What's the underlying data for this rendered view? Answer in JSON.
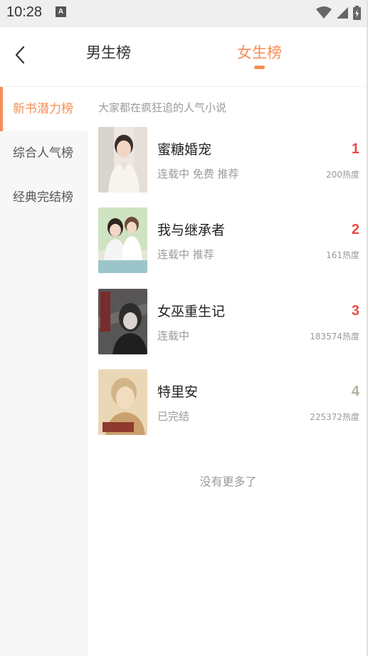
{
  "status_bar": {
    "time": "10:28",
    "notification_letter": "A",
    "icons": [
      "wifi-icon",
      "signal-icon",
      "battery-charging-icon"
    ]
  },
  "header": {
    "back_icon": "back-chevron-icon",
    "tabs": [
      {
        "label": "男生榜",
        "active": false
      },
      {
        "label": "女生榜",
        "active": true
      }
    ],
    "accent_color": "#f58d55"
  },
  "sidebar": {
    "items": [
      {
        "label": "新书潜力榜",
        "active": true
      },
      {
        "label": "综合人气榜",
        "active": false
      },
      {
        "label": "经典完结榜",
        "active": false
      }
    ]
  },
  "content": {
    "subtitle": "大家都在疯狂追的人气小说",
    "books": [
      {
        "rank": "1",
        "title": "蜜糖婚宠",
        "tags": "连载中 免费 推荐",
        "heat": "200热度",
        "rank_color": "#e94b45"
      },
      {
        "rank": "2",
        "title": "我与继承者",
        "tags": "连载中 推荐",
        "heat": "161热度",
        "rank_color": "#e94b45"
      },
      {
        "rank": "3",
        "title": "女巫重生记",
        "tags": "连载中",
        "heat": "183574热度",
        "rank_color": "#e94b45"
      },
      {
        "rank": "4",
        "title": "特里安",
        "tags": "已完结",
        "heat": "225372热度",
        "rank_color": "#b8ada0"
      }
    ],
    "end_text": "没有更多了"
  }
}
